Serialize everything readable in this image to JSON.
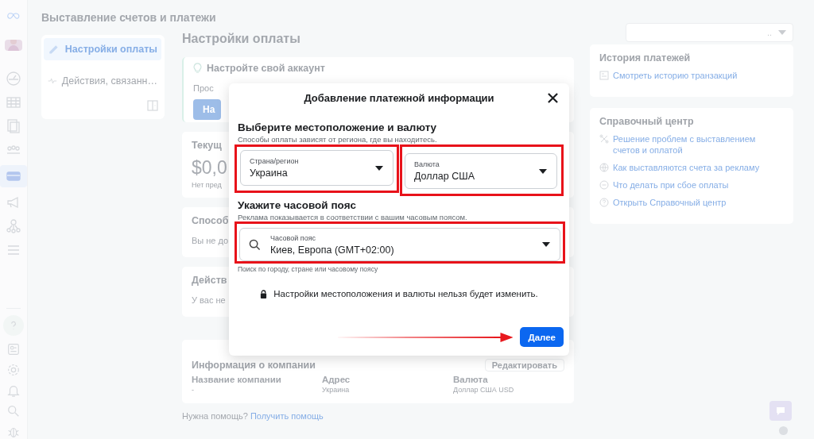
{
  "header": {
    "title": "Выставление счетов и платежи"
  },
  "rail_items": [
    {
      "selected": false
    },
    {
      "selected": false
    },
    {
      "selected": false
    },
    {
      "selected": false
    },
    {
      "selected": true
    },
    {
      "selected": false
    },
    {
      "selected": false
    },
    {
      "selected": false
    }
  ],
  "nav": {
    "items": [
      {
        "label": "Настройки оплаты",
        "selected": true
      },
      {
        "label": "Действия, связанн…",
        "selected": false
      }
    ]
  },
  "main": {
    "title": "Настройки оплаты",
    "alert": {
      "title": "Настройте свой аккаунт",
      "text": "Прос",
      "button": "На"
    },
    "cards": [
      {
        "kind": "amount",
        "title": "Текущ",
        "amount": "$0,0",
        "note": "Нет пред"
      },
      {
        "kind": "text",
        "title": "Способ",
        "text": "Вы не до"
      },
      {
        "kind": "text",
        "title": "Действ",
        "text": "У вас не"
      }
    ],
    "company": {
      "title": "Информация о компании",
      "button": "Редактировать",
      "fields": [
        {
          "label": "Название компании",
          "value": "-"
        },
        {
          "label": "Адрес",
          "value": "Украина"
        },
        {
          "label": "Валюта",
          "value": "Доллар США USD"
        }
      ]
    },
    "help": {
      "text": "Нужна помощь?",
      "link": "Получить помощь"
    }
  },
  "account_select": {
    "value": ".."
  },
  "history": {
    "title": "История платежей",
    "link": "Смотреть историю транзакций"
  },
  "help_center": {
    "title": "Справочный центр",
    "links": [
      "Решение проблем с выставлением счетов и оплатой",
      "Как выставляются счета за рекламу",
      "Что делать при сбое оплаты",
      "Открыть Справочный центр"
    ]
  },
  "dialog": {
    "title": "Добавление платежной информации",
    "location": {
      "heading": "Выберите местоположение и валюту",
      "subtitle": "Способы оплаты зависят от региона, где вы находитесь.",
      "country": {
        "label": "Страна/регион",
        "value": "Украина"
      },
      "currency": {
        "label": "Валюта",
        "value": "Доллар США"
      }
    },
    "timezone": {
      "heading": "Укажите часовой пояс",
      "subtitle": "Реклама показывается в соответствии с вашим часовым поясом.",
      "label": "Часовой пояс",
      "value": "Киев, Европа (GMT+02:00)",
      "hint": "Поиск по городу, стране или часовому поясу"
    },
    "notice": "Настройки местоположения и валюты нельзя будет изменить.",
    "button": "Далее"
  }
}
